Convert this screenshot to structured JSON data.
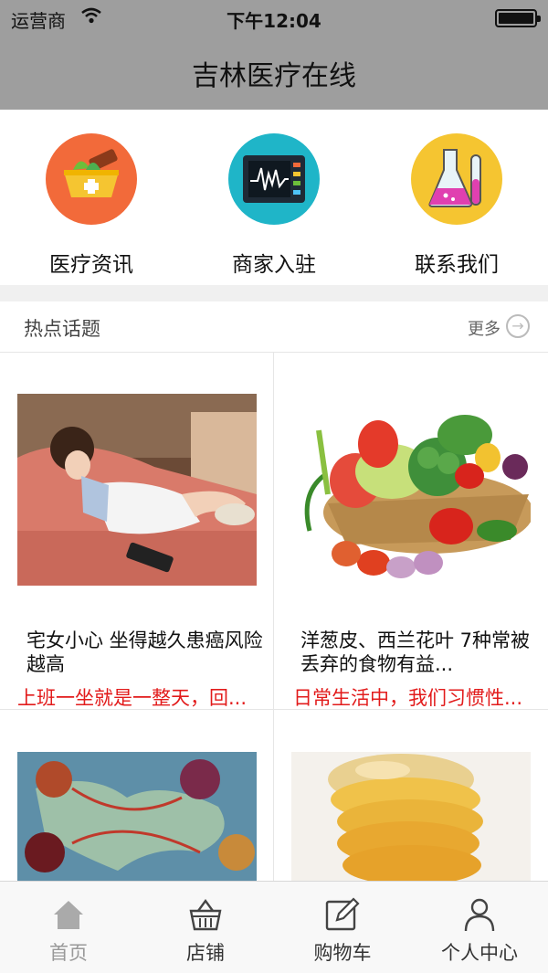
{
  "status_bar": {
    "carrier": "运营商",
    "time": "下午12:04"
  },
  "header": {
    "title": "吉林医疗在线"
  },
  "quick_nav": [
    {
      "label": "医疗资讯",
      "icon": "medicine-bowl-icon",
      "color": "#f26a3a"
    },
    {
      "label": "商家入驻",
      "icon": "monitor-icon",
      "color": "#1fb5c8"
    },
    {
      "label": "联系我们",
      "icon": "flask-icon",
      "color": "#f5c531"
    }
  ],
  "hot_topics": {
    "title": "热点话题",
    "more_label": "更多",
    "cards": [
      {
        "title": "宅女小心 坐得越久患癌风险越高",
        "summary": "上班一坐就是一整天，回..."
      },
      {
        "title": "洋葱皮、西兰花叶 7种常被丢弃的食物有益...",
        "summary": "日常生活中，我们习惯性..."
      }
    ]
  },
  "tab_bar": [
    {
      "label": "首页",
      "icon": "home-icon",
      "active": true
    },
    {
      "label": "店铺",
      "icon": "basket-icon",
      "active": false
    },
    {
      "label": "购物车",
      "icon": "edit-icon",
      "active": false
    },
    {
      "label": "个人中心",
      "icon": "user-icon",
      "active": false
    }
  ],
  "colors": {
    "header_bg": "#9e9e9e",
    "summary_red": "#e21b1b",
    "inactive_tab": "#999999"
  }
}
